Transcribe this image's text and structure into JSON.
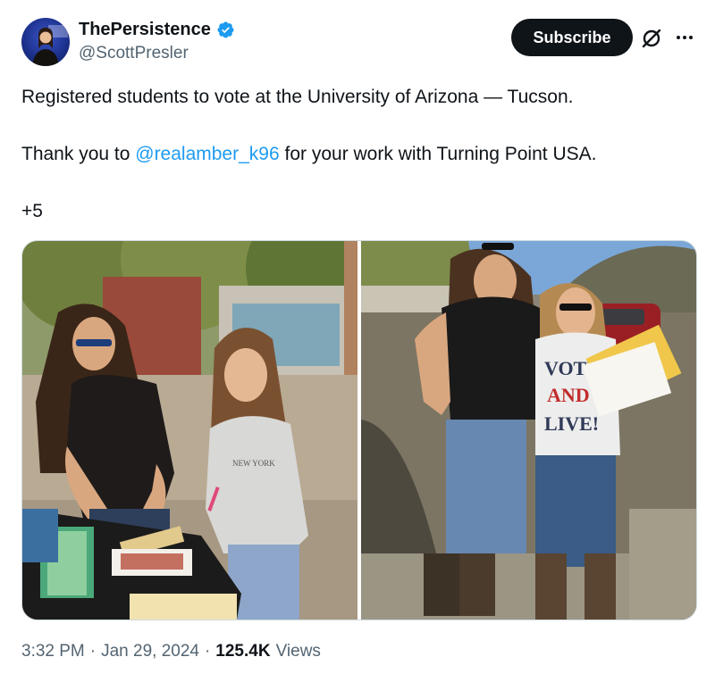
{
  "author": {
    "display_name": "ThePersistence",
    "handle": "@ScottPresler",
    "verified_color": "#1d9bf0"
  },
  "actions": {
    "subscribe_label": "Subscribe",
    "grok_icon": "grok-icon",
    "more_icon": "more-horizontal-icon"
  },
  "tweet": {
    "line1": "Registered students to vote at the University of Arizona — Tucson.",
    "line2_prefix": "Thank you to ",
    "mention": "@realamber_k96",
    "line2_suffix": " for your work with Turning Point USA.",
    "line3": "+5"
  },
  "media": {
    "photo1_sign_text": "NEW YORK",
    "photo2_shirt_text": [
      "VOTE",
      "AND",
      "LIVE!"
    ]
  },
  "meta": {
    "time": "3:32 PM",
    "separator": "·",
    "date": "Jan 29, 2024",
    "views_count": "125.4K",
    "views_label": "Views"
  },
  "colors": {
    "accent": "#1d9bf0",
    "text": "#0f1419",
    "secondary": "#536471"
  }
}
